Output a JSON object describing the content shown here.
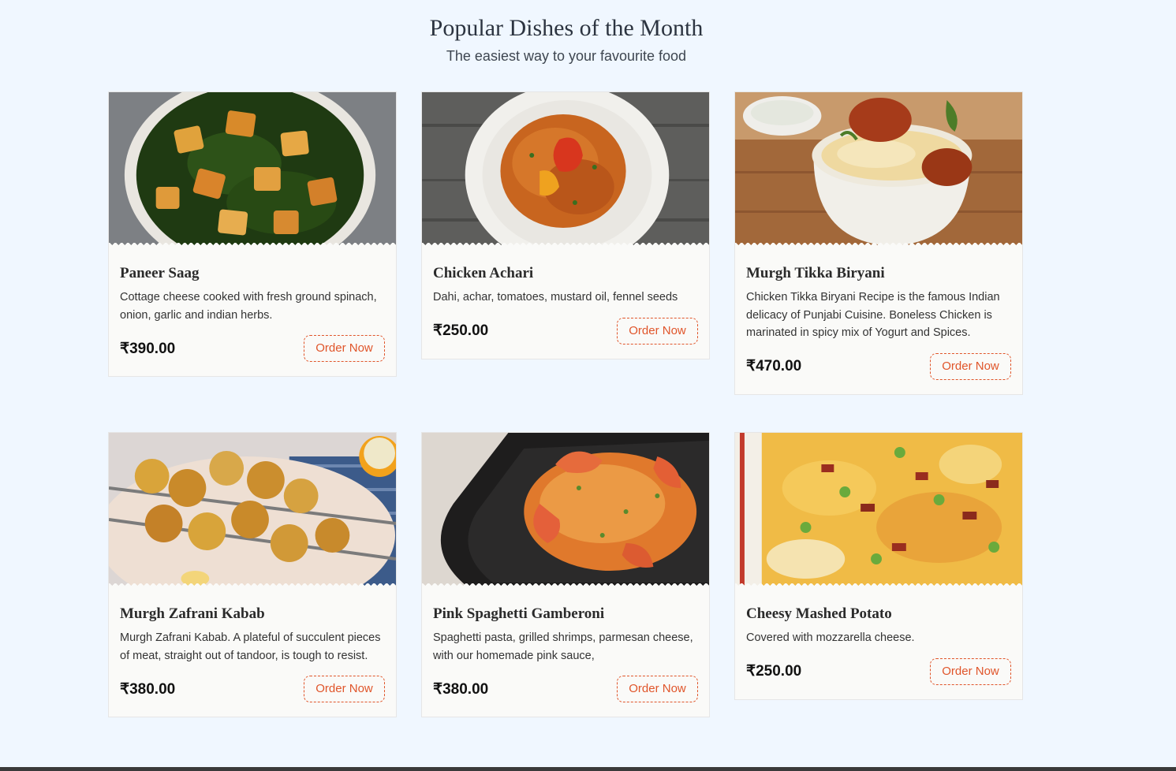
{
  "header": {
    "title": "Popular Dishes of the Month",
    "subtitle": "The easiest way to your favourite food"
  },
  "dishes": [
    {
      "name": "Paneer Saag",
      "description": "Cottage cheese cooked with fresh ground spinach, onion, garlic and indian herbs.",
      "price": "₹390.00",
      "order_label": "Order Now",
      "image": "paneer-saag-photo"
    },
    {
      "name": "Chicken Achari",
      "description": "Dahi, achar, tomatoes, mustard oil, fennel seeds",
      "price": "₹250.00",
      "order_label": "Order Now",
      "image": "chicken-achari-photo"
    },
    {
      "name": "Murgh Tikka Biryani",
      "description": "Chicken Tikka Biryani Recipe is the famous Indian delicacy of Punjabi Cuisine. Boneless Chicken is marinated in spicy mix of Yogurt and Spices.",
      "price": "₹470.00",
      "order_label": "Order Now",
      "image": "murgh-tikka-biryani-photo"
    },
    {
      "name": "Murgh Zafrani Kabab",
      "description": "Murgh Zafrani Kabab. A plateful of succulent pieces of meat, straight out of tandoor, is tough to resist.",
      "price": "₹380.00",
      "order_label": "Order Now",
      "image": "murgh-zafrani-kabab-photo"
    },
    {
      "name": "Pink Spaghetti Gamberoni",
      "description": "Spaghetti pasta, grilled shrimps, parmesan cheese, with our homemade pink sauce,",
      "price": "₹380.00",
      "order_label": "Order Now",
      "image": "pink-spaghetti-gamberoni-photo"
    },
    {
      "name": "Cheesy Mashed Potato",
      "description": "Covered with mozzarella cheese.",
      "price": "₹250.00",
      "order_label": "Order Now",
      "image": "cheesy-mashed-potato-photo"
    }
  ],
  "colors": {
    "page_background": "#f0f7ff",
    "card_background": "#fafaf8",
    "accent": "#e0552a"
  }
}
